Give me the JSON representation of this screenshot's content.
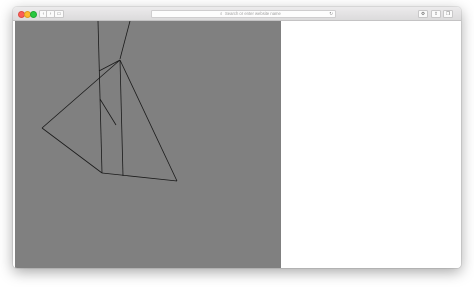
{
  "browser": {
    "address_bar": {
      "placeholder": "Search or enter website name",
      "search_icon": "magnifier-icon",
      "reload_icon": "reload-icon"
    },
    "nav": {
      "back_glyph": "‹",
      "forward_glyph": "›",
      "sidebar_glyph": "▭"
    },
    "toolbar_right": {
      "settings_glyph": "⚙",
      "share_glyph": "⇪",
      "tabs_glyph": "❐"
    }
  },
  "canvas": {
    "background_color": "#808080",
    "stroke_color": "#1a1a1a"
  }
}
